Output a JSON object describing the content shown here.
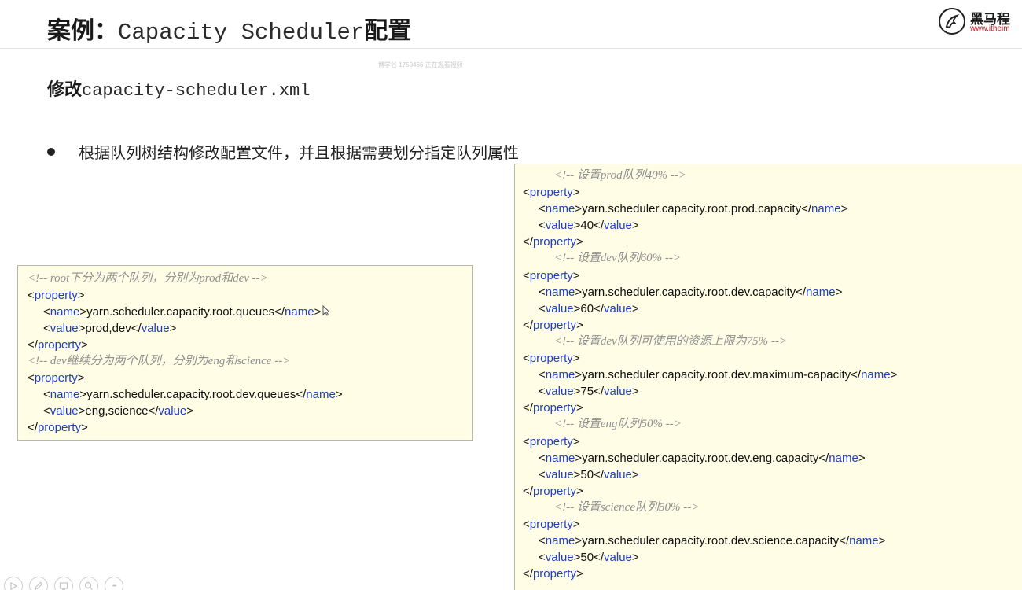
{
  "header": {
    "title_prefix": "案例：",
    "title_code": "Capacity Scheduler",
    "title_suffix": "配置"
  },
  "logo": {
    "name": "黑马程",
    "url": "www.itheim"
  },
  "watermark": "博学谷 1750466 正在观看视频",
  "subtitle": {
    "prefix": "修改",
    "filename": "capacity-scheduler.xml"
  },
  "bullet": "根据队列树结构修改配置文件，并且根据需要划分指定队列属性",
  "left_code": {
    "comment1": "<!-- root下分为两个队列，分别为prod和dev -->",
    "p1_name": "yarn.scheduler.capacity.root.queues",
    "p1_value": "prod,dev",
    "comment2": "<!-- dev继续分为两个队列，分别为eng和science -->",
    "p2_name": "yarn.scheduler.capacity.root.dev.queues",
    "p2_value": "eng,science"
  },
  "right_code": {
    "blocks": [
      {
        "comment": "<!-- 设置prod队列40% -->",
        "name": "yarn.scheduler.capacity.root.prod.capacity",
        "value": "40"
      },
      {
        "comment": "<!-- 设置dev队列60% -->",
        "name": "yarn.scheduler.capacity.root.dev.capacity",
        "value": "60"
      },
      {
        "comment": "<!-- 设置dev队列可使用的资源上限为75% -->",
        "name": "yarn.scheduler.capacity.root.dev.maximum-capacity",
        "value": "75"
      },
      {
        "comment": "<!-- 设置eng队列50% -->",
        "name": "yarn.scheduler.capacity.root.dev.eng.capacity",
        "value": "50"
      },
      {
        "comment": "<!-- 设置science队列50% -->",
        "name": "yarn.scheduler.capacity.root.dev.science.capacity",
        "value": "50"
      }
    ]
  },
  "xml_tags": {
    "property": "property",
    "name": "name",
    "value": "value"
  },
  "toolbar": {
    "icons": [
      "play-icon",
      "pen-icon",
      "screen-icon",
      "zoom-icon",
      "more-icon"
    ],
    "more_label": "•••"
  },
  "colors": {
    "tag": "#1f3fbf",
    "comment": "#8f8f8f",
    "code_bg": "#fffde6",
    "logo_accent": "#c8161d"
  }
}
